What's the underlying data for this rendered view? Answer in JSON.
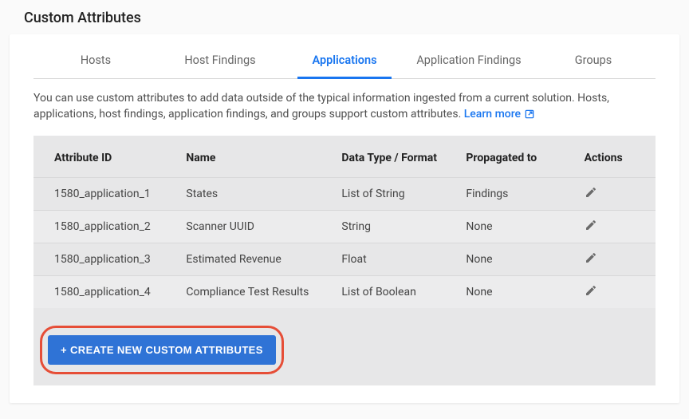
{
  "page_title": "Custom Attributes",
  "tabs": [
    {
      "label": "Hosts",
      "active": false
    },
    {
      "label": "Host Findings",
      "active": false
    },
    {
      "label": "Applications",
      "active": true
    },
    {
      "label": "Application Findings",
      "active": false
    },
    {
      "label": "Groups",
      "active": false
    }
  ],
  "description": "You can use custom attributes to add data outside of the typical information ingested from a current solution. Hosts, applications, host findings, application findings, and groups support custom attributes.",
  "learn_more_label": "Learn more",
  "columns": {
    "id": "Attribute ID",
    "name": "Name",
    "type": "Data Type / Format",
    "prop": "Propagated to",
    "actions": "Actions"
  },
  "rows": [
    {
      "id": "1580_application_1",
      "name": "States",
      "type": "List of String",
      "prop": "Findings"
    },
    {
      "id": "1580_application_2",
      "name": "Scanner UUID",
      "type": "String",
      "prop": "None"
    },
    {
      "id": "1580_application_3",
      "name": "Estimated Revenue",
      "type": "Float",
      "prop": "None"
    },
    {
      "id": "1580_application_4",
      "name": "Compliance Test Results",
      "type": "List of Boolean",
      "prop": "None"
    }
  ],
  "create_button_label": "+ CREATE NEW CUSTOM ATTRIBUTES"
}
